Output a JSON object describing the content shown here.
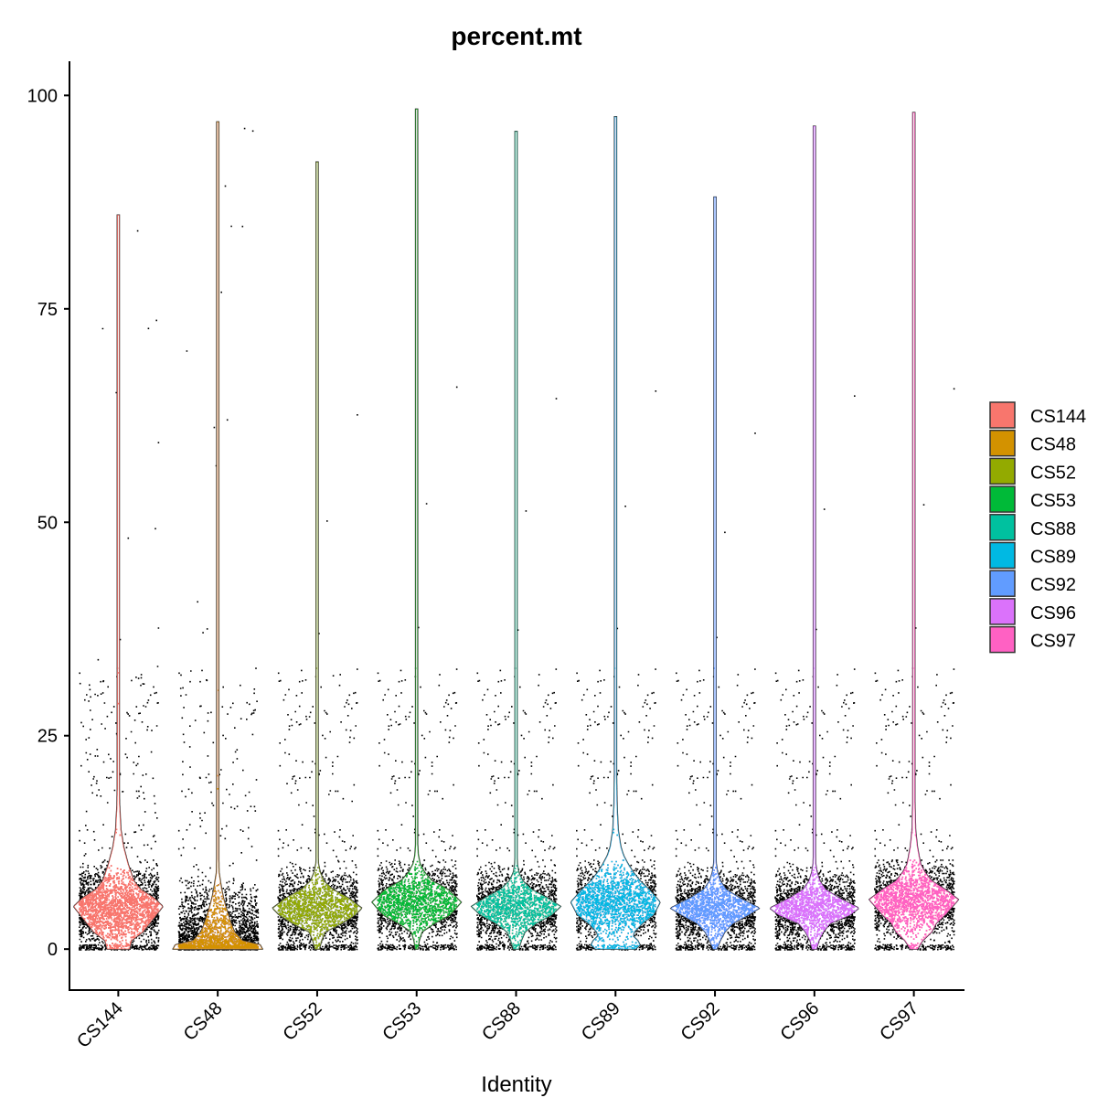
{
  "chart_data": {
    "type": "violin",
    "title": "percent.mt",
    "xlabel": "Identity",
    "ylabel": "",
    "ylim": [
      -4.8,
      104
    ],
    "yticks": [
      0,
      25,
      50,
      75,
      100
    ],
    "ytick_labels": [
      "0",
      "25",
      "50",
      "75",
      "100"
    ],
    "grid": false,
    "legend_position": "right",
    "legend_title": "",
    "points_shown": true,
    "categories": [
      "CS144",
      "CS48",
      "CS52",
      "CS53",
      "CS88",
      "CS89",
      "CS92",
      "CS96",
      "CS97"
    ],
    "series": [
      {
        "name": "CS144",
        "color": "#F8766D",
        "min": 0.0,
        "max": 86.0,
        "mode": 5.0,
        "density": [
          [
            0,
            0.25
          ],
          [
            1,
            0.3
          ],
          [
            2,
            0.55
          ],
          [
            3,
            0.7
          ],
          [
            4,
            0.85
          ],
          [
            5,
            1.0
          ],
          [
            6,
            0.8
          ],
          [
            7,
            0.5
          ],
          [
            8,
            0.35
          ],
          [
            10,
            0.22
          ],
          [
            12,
            0.12
          ],
          [
            14,
            0.06
          ],
          [
            17,
            0.03
          ],
          [
            22,
            0.015
          ],
          [
            30,
            0.01
          ],
          [
            86,
            0.008
          ]
        ]
      },
      {
        "name": "CS48",
        "color": "#D39200",
        "min": 0.0,
        "max": 96.9,
        "mode": 0.3,
        "density": [
          [
            0,
            1.0
          ],
          [
            0.5,
            0.95
          ],
          [
            1,
            0.55
          ],
          [
            2,
            0.38
          ],
          [
            3,
            0.3
          ],
          [
            4,
            0.24
          ],
          [
            5,
            0.18
          ],
          [
            6,
            0.13
          ],
          [
            7,
            0.09
          ],
          [
            8,
            0.06
          ],
          [
            9,
            0.03
          ],
          [
            12,
            0.02
          ],
          [
            20,
            0.012
          ],
          [
            35,
            0.01
          ],
          [
            97,
            0.008
          ]
        ]
      },
      {
        "name": "CS52",
        "color": "#93AA00",
        "min": 0.0,
        "max": 92.2,
        "mode": 4.8,
        "density": [
          [
            0,
            0.05
          ],
          [
            1,
            0.1
          ],
          [
            2,
            0.18
          ],
          [
            3,
            0.55
          ],
          [
            4,
            0.85
          ],
          [
            4.8,
            1.0
          ],
          [
            6,
            0.7
          ],
          [
            7,
            0.35
          ],
          [
            8,
            0.15
          ],
          [
            9,
            0.07
          ],
          [
            10,
            0.03
          ],
          [
            12,
            0.015
          ],
          [
            92,
            0.008
          ]
        ]
      },
      {
        "name": "CS53",
        "color": "#00BA38",
        "min": 0.0,
        "max": 98.4,
        "mode": 5.5,
        "density": [
          [
            0,
            0.03
          ],
          [
            1,
            0.06
          ],
          [
            2,
            0.12
          ],
          [
            3,
            0.4
          ],
          [
            4,
            0.75
          ],
          [
            5.5,
            1.0
          ],
          [
            7,
            0.7
          ],
          [
            8,
            0.35
          ],
          [
            9,
            0.18
          ],
          [
            10,
            0.08
          ],
          [
            11,
            0.04
          ],
          [
            13,
            0.015
          ],
          [
            98.4,
            0.008
          ]
        ]
      },
      {
        "name": "CS88",
        "color": "#00C19F",
        "min": 0.0,
        "max": 95.8,
        "mode": 5.0,
        "density": [
          [
            0,
            0.06
          ],
          [
            1,
            0.12
          ],
          [
            2,
            0.2
          ],
          [
            3,
            0.45
          ],
          [
            4,
            0.8
          ],
          [
            5,
            1.0
          ],
          [
            6,
            0.7
          ],
          [
            7,
            0.35
          ],
          [
            8,
            0.15
          ],
          [
            9,
            0.06
          ],
          [
            10,
            0.03
          ],
          [
            12,
            0.015
          ],
          [
            95.8,
            0.008
          ]
        ]
      },
      {
        "name": "CS89",
        "color": "#00B9E3",
        "min": 0.0,
        "max": 97.5,
        "mode": 5.5,
        "density": [
          [
            0,
            0.45
          ],
          [
            0.5,
            0.55
          ],
          [
            1,
            0.5
          ],
          [
            1.5,
            0.4
          ],
          [
            2,
            0.42
          ],
          [
            3,
            0.6
          ],
          [
            4,
            0.85
          ],
          [
            5.5,
            1.0
          ],
          [
            7,
            0.75
          ],
          [
            8,
            0.55
          ],
          [
            9,
            0.4
          ],
          [
            10,
            0.28
          ],
          [
            11,
            0.18
          ],
          [
            12,
            0.12
          ],
          [
            14,
            0.06
          ],
          [
            17,
            0.035
          ],
          [
            22,
            0.02
          ],
          [
            30,
            0.012
          ],
          [
            97.5,
            0.008
          ]
        ]
      },
      {
        "name": "CS92",
        "color": "#619CFF",
        "min": 0.0,
        "max": 88.1,
        "mode": 4.8,
        "density": [
          [
            0,
            0.04
          ],
          [
            1,
            0.12
          ],
          [
            2,
            0.22
          ],
          [
            3,
            0.4
          ],
          [
            4,
            0.75
          ],
          [
            4.8,
            1.0
          ],
          [
            6,
            0.55
          ],
          [
            7,
            0.25
          ],
          [
            8,
            0.12
          ],
          [
            9,
            0.06
          ],
          [
            10,
            0.03
          ],
          [
            12,
            0.015
          ],
          [
            88.1,
            0.008
          ]
        ]
      },
      {
        "name": "CS96",
        "color": "#DB72FB",
        "min": 0.0,
        "max": 96.4,
        "mode": 4.8,
        "density": [
          [
            0,
            0.05
          ],
          [
            1,
            0.1
          ],
          [
            2,
            0.2
          ],
          [
            3,
            0.35
          ],
          [
            4,
            0.8
          ],
          [
            4.8,
            1.0
          ],
          [
            6,
            0.55
          ],
          [
            7,
            0.25
          ],
          [
            8,
            0.12
          ],
          [
            9,
            0.06
          ],
          [
            10,
            0.03
          ],
          [
            13,
            0.015
          ],
          [
            96.4,
            0.008
          ]
        ]
      },
      {
        "name": "CS97",
        "color": "#FF61C3",
        "min": 0.0,
        "max": 98.0,
        "mode": 5.8,
        "density": [
          [
            0,
            0.08
          ],
          [
            1,
            0.2
          ],
          [
            2,
            0.4
          ],
          [
            3,
            0.5
          ],
          [
            4,
            0.7
          ],
          [
            5.8,
            1.0
          ],
          [
            7,
            0.7
          ],
          [
            8,
            0.4
          ],
          [
            9,
            0.25
          ],
          [
            10,
            0.15
          ],
          [
            12,
            0.08
          ],
          [
            14,
            0.04
          ],
          [
            18,
            0.02
          ],
          [
            25,
            0.012
          ],
          [
            98,
            0.008
          ]
        ]
      }
    ]
  }
}
